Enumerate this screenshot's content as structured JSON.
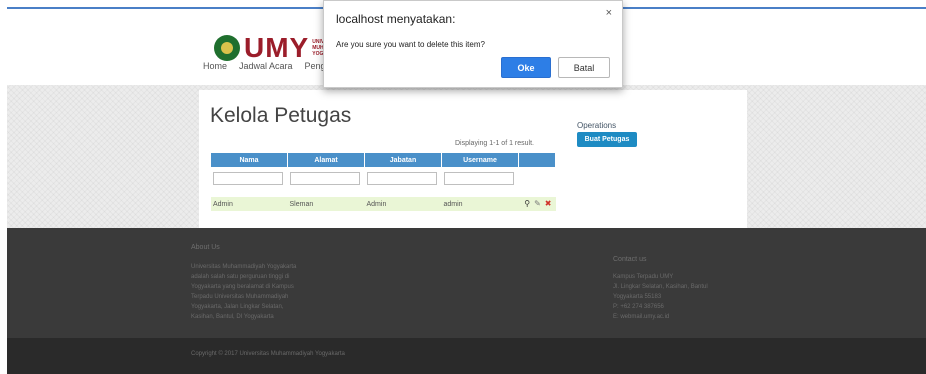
{
  "header": {
    "logo_text": "UMY",
    "logo_sub": [
      "UNIVERS",
      "MUHAM",
      "YOGYAK"
    ],
    "nav": [
      "Home",
      "Jadwal Acara",
      "Penggu"
    ]
  },
  "main": {
    "title": "Kelola Petugas",
    "summary": "Displaying 1-1 of 1 result.",
    "columns": [
      "Nama",
      "Alamat",
      "Jabatan",
      "Username"
    ],
    "rows": [
      {
        "nama": "Admin",
        "alamat": "Sleman",
        "jabatan": "Admin",
        "username": "admin"
      }
    ],
    "row_action_icons": [
      "view-icon",
      "edit-icon",
      "delete-icon"
    ]
  },
  "operations": {
    "title": "Operations",
    "create_label": "Buat Petugas"
  },
  "footer": {
    "about_title": "About Us",
    "about_lines": [
      "Universitas Muhammadiyah Yogyakarta",
      "adalah salah satu perguruan tinggi di",
      "Yogyakarta yang beralamat di Kampus",
      "Terpadu Universitas Muhammadiyah",
      "Yogyakarta, Jalan Lingkar Selatan,",
      "Kasihan, Bantul, DI Yogyakarta"
    ],
    "contact_title": "Contact us",
    "contact_lines": [
      "Kampus Terpadu UMY",
      "Jl. Lingkar Selatan, Kasihan, Bantul",
      "Yogyakarta 55183",
      "P: +62 274 387656",
      "E: webmail.umy.ac.id"
    ],
    "copyright": "Copyright © 2017 Universitas Muhammadiyah Yogyakarta"
  },
  "dialog": {
    "title": "localhost menyatakan:",
    "message": "Are you sure you want to delete this item?",
    "ok_label": "Oke",
    "cancel_label": "Batal",
    "close_glyph": "×"
  },
  "colors": {
    "accent": "#4a90c9",
    "brand": "#9b1d2a",
    "ok_button": "#2d7ee6",
    "row_highlight": "#eaf6d6"
  }
}
